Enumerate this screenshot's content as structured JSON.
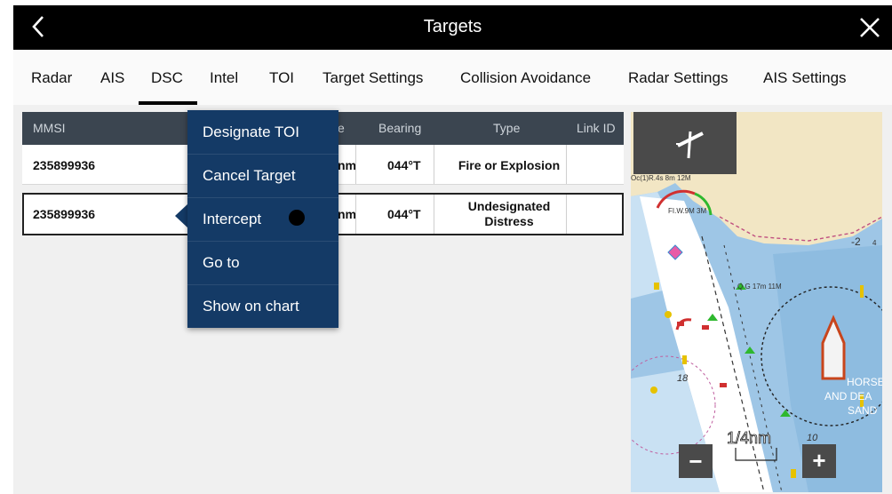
{
  "header": {
    "title": "Targets"
  },
  "tabs": [
    {
      "label": "Radar"
    },
    {
      "label": "AIS"
    },
    {
      "label": "DSC"
    },
    {
      "label": "Intel"
    },
    {
      "label": "TOI"
    },
    {
      "label": "Target Settings"
    },
    {
      "label": "Collision Avoidance"
    },
    {
      "label": "Radar Settings"
    },
    {
      "label": "AIS Settings"
    }
  ],
  "active_tab": "DSC",
  "table": {
    "columns": [
      "MMSI",
      "e",
      "Bearing",
      "Type",
      "Link ID"
    ],
    "rows": [
      {
        "mmsi": "235899936",
        "range": "nm",
        "bearing": "044°T",
        "type": "Fire or Explosion",
        "link": ""
      },
      {
        "mmsi": "235899936",
        "range": "nm",
        "bearing": "044°T",
        "type": "Undesignated Distress",
        "link": ""
      }
    ]
  },
  "context_menu": {
    "items": [
      {
        "label": "Designate TOI"
      },
      {
        "label": "Cancel Target"
      },
      {
        "label": "Intercept"
      },
      {
        "label": "Go to"
      },
      {
        "label": "Show on chart"
      }
    ]
  },
  "map": {
    "scale_label": "1/4nm",
    "zoom_out": "−",
    "zoom_in": "+",
    "labels": [
      "Oc(1)R.4s 8m 12M",
      "FI.W.9M 3M",
      "Q G 17m 11M",
      "18",
      "HORSE",
      "AND DEA",
      "SAND",
      "10",
      "-2",
      "4"
    ]
  },
  "colors": {
    "titlebar": "#000000",
    "table_header": "#3b4550",
    "menu": "#143a66",
    "land": "#f2e6c4",
    "water": "#9ec6e6",
    "channel": "#ffffff"
  }
}
